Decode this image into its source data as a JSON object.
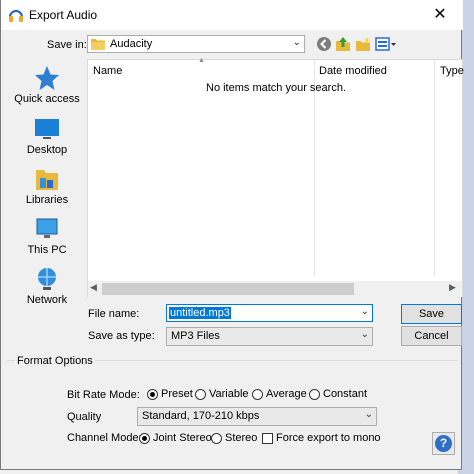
{
  "window": {
    "title": "Export Audio"
  },
  "savein": {
    "label": "Save in:",
    "folder": "Audacity"
  },
  "places": [
    {
      "label": "Quick access",
      "icon": "star-icon"
    },
    {
      "label": "Desktop",
      "icon": "desktop-icon"
    },
    {
      "label": "Libraries",
      "icon": "libraries-icon"
    },
    {
      "label": "This PC",
      "icon": "computer-icon"
    },
    {
      "label": "Network",
      "icon": "network-icon"
    }
  ],
  "filelist": {
    "columns": {
      "name": "Name",
      "date": "Date modified",
      "type": "Type"
    },
    "empty_text": "No items match your search."
  },
  "filename": {
    "label": "File name:",
    "value": "untitled.mp3"
  },
  "filetype": {
    "label": "Save as type:",
    "value": "MP3 Files"
  },
  "buttons": {
    "save": "Save",
    "cancel": "Cancel"
  },
  "format_options": {
    "legend": "Format Options",
    "bitrate_label": "Bit Rate Mode:",
    "bitrate_modes": [
      "Preset",
      "Variable",
      "Average",
      "Constant"
    ],
    "bitrate_selected": "Preset",
    "quality_label": "Quality",
    "quality_value": "Standard, 170-210 kbps",
    "channel_label": "Channel Mode:",
    "channel_modes": [
      "Joint Stereo",
      "Stereo"
    ],
    "channel_selected": "Joint Stereo",
    "force_mono_label": "Force export to mono",
    "force_mono_checked": false
  },
  "help": {
    "label": "?"
  },
  "colors": {
    "accent": "#0078d7",
    "folder": "#e8b93c",
    "help": "#2d6ec7"
  }
}
